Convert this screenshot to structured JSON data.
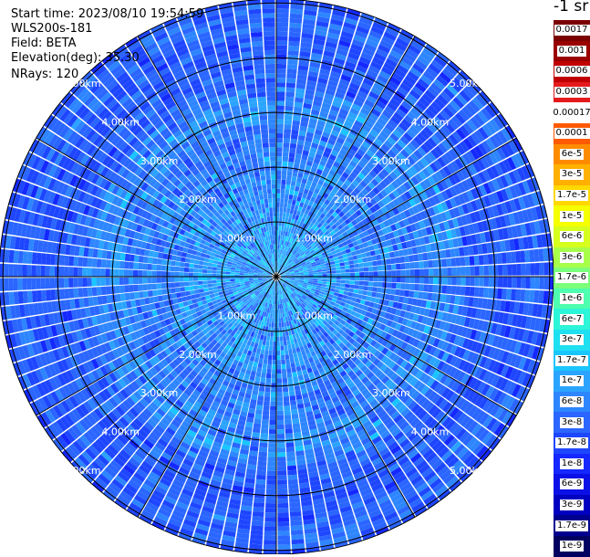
{
  "header": {
    "start_time": "Start time: 2023/08/10 19:54:59",
    "instrument": "WLS200s-181",
    "field": "Field: BETA",
    "elevation": "Elevation(deg): 35.30",
    "nrays": "NRays: 120"
  },
  "colorbar": {
    "unit": "-1 sr",
    "labels": [
      "0.0017",
      "0.001",
      "0.0006",
      "0.0003",
      "0.00017",
      "0.0001",
      "6e-5",
      "3e-5",
      "1.7e-5",
      "1e-5",
      "6e-6",
      "3e-6",
      "1.7e-6",
      "1e-6",
      "6e-7",
      "3e-7",
      "1.7e-7",
      "1e-7",
      "6e-8",
      "3e-8",
      "1.7e-8",
      "1e-8",
      "6e-9",
      "3e-9",
      "1.7e-9",
      "1e-9"
    ],
    "colors": [
      "#7a0000",
      "#9a0000",
      "#c00000",
      "#e41a1c",
      "#ffffff",
      "#ff5a00",
      "#ff8c00",
      "#ffb000",
      "#ffd800",
      "#f5ff00",
      "#d6ff1e",
      "#a8ff4a",
      "#7cff7a",
      "#4dffae",
      "#2cf5d8",
      "#1ee0f0",
      "#19c6ff",
      "#2ba4ff",
      "#2e86ff",
      "#2a66ff",
      "#1e46ff",
      "#1428ff",
      "#0a10e6",
      "#0000c0",
      "#00008f",
      "#000060"
    ]
  },
  "chart_data": {
    "type": "heatmap",
    "projection": "polar PPI scan",
    "field": "BETA",
    "units": "-1 sr",
    "n_rays": 120,
    "elevation_deg": 35.3,
    "range_rings_km": [
      1,
      2,
      3,
      4,
      5
    ],
    "range_labels": [
      "1.00km",
      "2.00km",
      "3.00km",
      "4.00km",
      "5.00km"
    ],
    "spokes_deg": [
      0,
      30,
      60,
      90,
      120,
      150,
      180,
      210,
      240,
      270,
      300,
      330
    ],
    "max_range_km": 5.07,
    "value_scale": "log",
    "value_range": [
      1e-09,
      0.0017
    ],
    "dominant_range": [
      1.7e-08,
      1.7e-07
    ]
  }
}
